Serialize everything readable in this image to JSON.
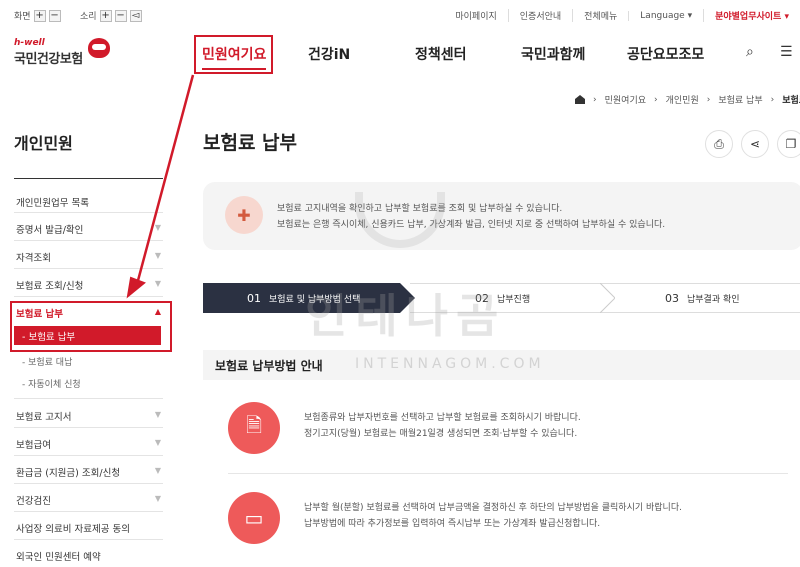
{
  "util": {
    "screen_label": "화면",
    "sound_label": "소리",
    "plus": "+",
    "minus": "−",
    "links": [
      "마이페이지",
      "인증서안내",
      "전체메뉴",
      "Language ▾",
      "분야별업무사이트 ▾"
    ]
  },
  "logo": {
    "tag": "h-well",
    "name": "국민건강보험"
  },
  "gnb": [
    "민원여기요",
    "건강iN",
    "정책센터",
    "국민과함께",
    "공단요모조모"
  ],
  "breadcrumb": [
    "민원여기요",
    "개인민원",
    "보험료 납부",
    "보험료 납부"
  ],
  "sidebar": {
    "title": "개인민원",
    "items": [
      "개인민원업무 목록",
      "증명서 발급/확인",
      "자격조회",
      "보험료 조회/신청",
      "보험료 납부",
      "보험료 고지서",
      "보험급여",
      "환급금 (지원금) 조회/신청",
      "건강검진",
      "사업장 의료비 자료제공 동의",
      "외국인 민원센터 예약"
    ],
    "subitems": [
      "보험료 납부",
      "보험료 대납",
      "자동이체 신청"
    ]
  },
  "main": {
    "title": "보험료 납부",
    "notice": [
      "보험료 고지내역을 확인하고 납부할 보험료를 조회 및 납부하실 수 있습니다.",
      "보험료는 은행 즉시이체, 신용카드 납부, 가상계좌 발급, 인터넷 지로 중 선택하여 납부하실 수 있습니다."
    ],
    "steps": [
      {
        "num": "01",
        "label": "보험료 및 납부방법 선택"
      },
      {
        "num": "02",
        "label": "납부진행"
      },
      {
        "num": "03",
        "label": "납부결과 확인"
      }
    ],
    "section_title": "보험료 납부방법 안내",
    "guide1": [
      "보험종류와 납부자번호를 선택하고 납부할 보험료를 조회하시기 바랍니다.",
      "정기고지(당월) 보험료는 매월21일경 생성되면 조회·납부할 수 있습니다."
    ],
    "guide2": [
      "납부할 월(분할) 보험료를 선택하여 납부금액을 결정하신 후 하단의 납부방법을 클릭하시기 바랍니다.",
      "납부방법에 따라 추가정보를 입력하여 즉시납부 또는 가상계좌 발급신청합니다."
    ]
  },
  "watermark": {
    "main": "인테나곰",
    "sub": "INTENNAGOM.COM"
  },
  "colors": {
    "brand_red": "#d11a2a",
    "step_dark": "#2b3142",
    "card_icon": "#ee5a5a"
  }
}
